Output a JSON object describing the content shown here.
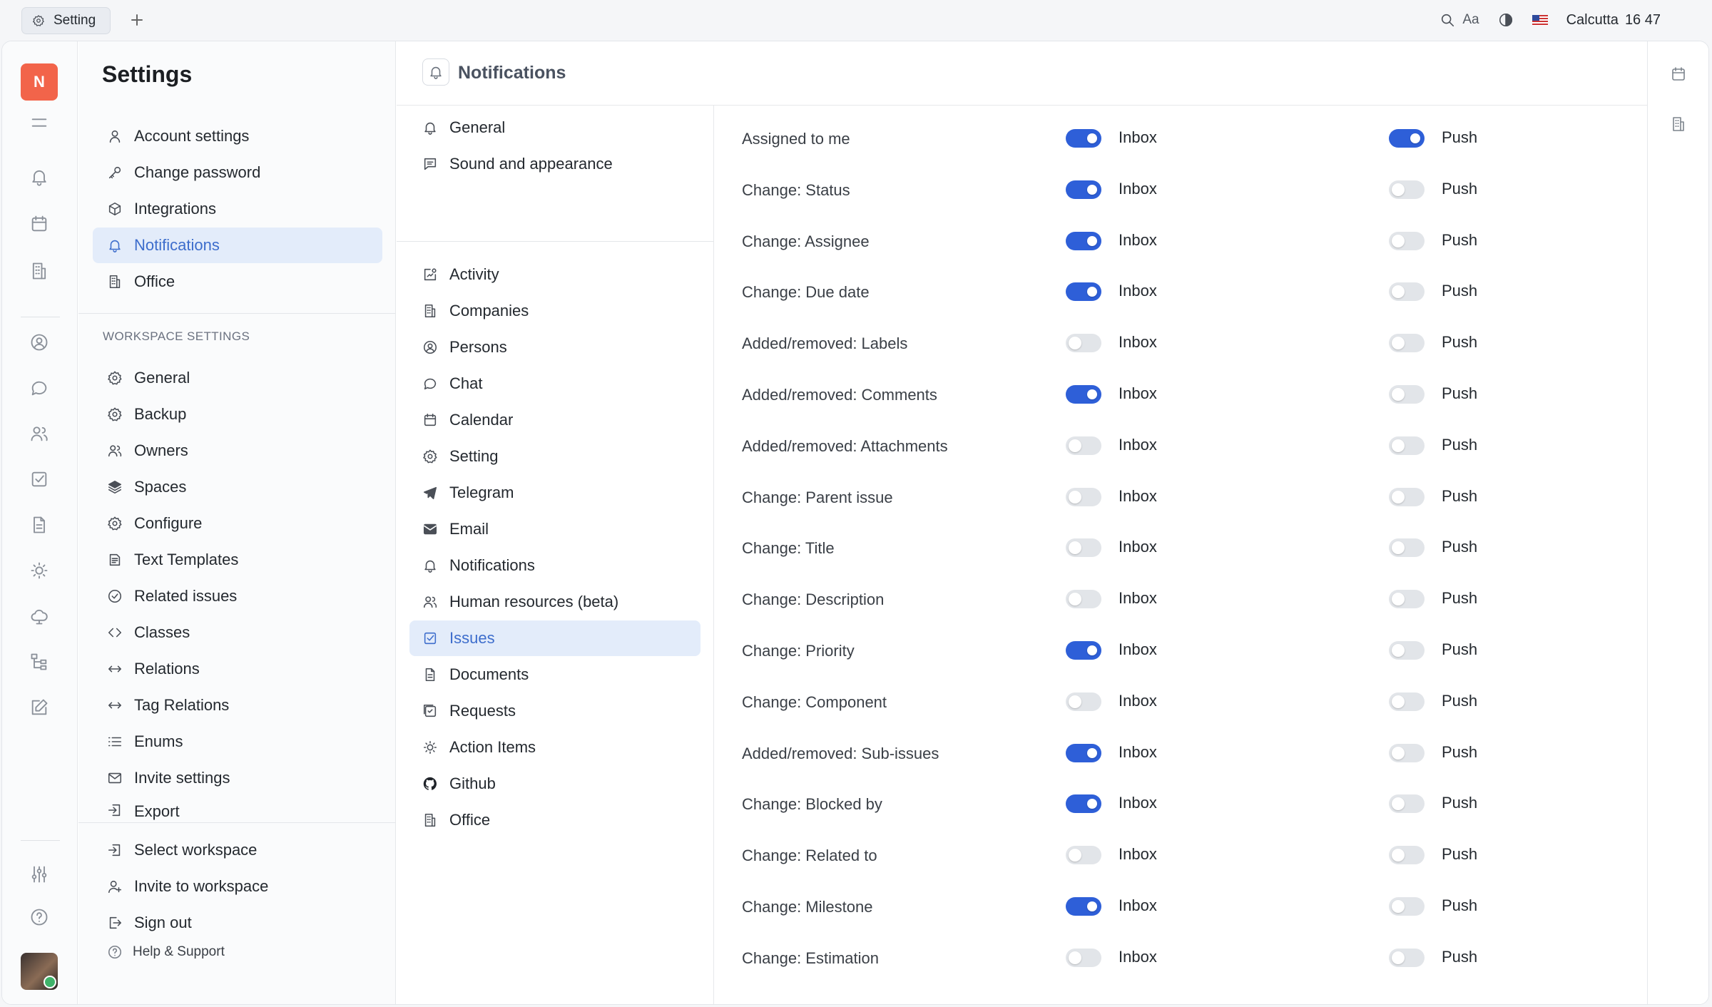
{
  "topbar": {
    "tab_label": "Setting",
    "font_label": "Aa",
    "city": "Calcutta",
    "time": "16 47"
  },
  "rail": {
    "workspace_initial": "N"
  },
  "settings": {
    "title": "Settings",
    "account_items": [
      {
        "label": "Account settings",
        "icon": "user-icon"
      },
      {
        "label": "Change password",
        "icon": "key-icon"
      },
      {
        "label": "Integrations",
        "icon": "cube-icon"
      },
      {
        "label": "Notifications",
        "icon": "bell-icon",
        "active": true
      },
      {
        "label": "Office",
        "icon": "building-icon"
      }
    ],
    "workspace_heading": "WORKSPACE SETTINGS",
    "workspace_items": [
      {
        "label": "General",
        "icon": "gear-icon"
      },
      {
        "label": "Backup",
        "icon": "gear-icon"
      },
      {
        "label": "Owners",
        "icon": "users-icon"
      },
      {
        "label": "Spaces",
        "icon": "layers-icon"
      },
      {
        "label": "Configure",
        "icon": "gear-icon"
      },
      {
        "label": "Text Templates",
        "icon": "template-icon"
      },
      {
        "label": "Related issues",
        "icon": "check-circle-icon"
      },
      {
        "label": "Classes",
        "icon": "code-icon"
      },
      {
        "label": "Relations",
        "icon": "arrows-icon"
      },
      {
        "label": "Tag Relations",
        "icon": "arrows-icon"
      },
      {
        "label": "Enums",
        "icon": "list-icon"
      },
      {
        "label": "Invite settings",
        "icon": "mail-icon"
      },
      {
        "label": "Export",
        "icon": "export-icon"
      }
    ],
    "bottom_items": [
      {
        "label": "Select workspace",
        "icon": "enter-icon"
      },
      {
        "label": "Invite to workspace",
        "icon": "user-plus-icon"
      },
      {
        "label": "Sign out",
        "icon": "signout-icon"
      }
    ],
    "help_label": "Help & Support"
  },
  "content": {
    "title": "Notifications",
    "top_categories": [
      {
        "label": "General",
        "icon": "bell-icon"
      },
      {
        "label": "Sound and appearance",
        "icon": "message-icon"
      }
    ],
    "categories": [
      {
        "label": "Activity",
        "icon": "activity-icon"
      },
      {
        "label": "Companies",
        "icon": "building-icon"
      },
      {
        "label": "Persons",
        "icon": "person-circle-icon"
      },
      {
        "label": "Chat",
        "icon": "chat-icon"
      },
      {
        "label": "Calendar",
        "icon": "calendar-icon"
      },
      {
        "label": "Setting",
        "icon": "gear-icon"
      },
      {
        "label": "Telegram",
        "icon": "telegram-icon"
      },
      {
        "label": "Email",
        "icon": "mail-filled-icon"
      },
      {
        "label": "Notifications",
        "icon": "bell-icon"
      },
      {
        "label": "Human resources (beta)",
        "icon": "users-icon"
      },
      {
        "label": "Issues",
        "icon": "checkbox-icon",
        "active": true
      },
      {
        "label": "Documents",
        "icon": "document-icon"
      },
      {
        "label": "Requests",
        "icon": "request-icon"
      },
      {
        "label": "Action Items",
        "icon": "sun-icon"
      },
      {
        "label": "Github",
        "icon": "github-icon"
      },
      {
        "label": "Office",
        "icon": "building-icon"
      }
    ],
    "inbox_label": "Inbox",
    "push_label": "Push",
    "rows": [
      {
        "label": "Assigned to me",
        "inbox": true,
        "push": true
      },
      {
        "label": "Change: Status",
        "inbox": true,
        "push": false
      },
      {
        "label": "Change: Assignee",
        "inbox": true,
        "push": false
      },
      {
        "label": "Change: Due date",
        "inbox": true,
        "push": false
      },
      {
        "label": "Added/removed: Labels",
        "inbox": false,
        "push": false
      },
      {
        "label": "Added/removed: Comments",
        "inbox": true,
        "push": false
      },
      {
        "label": "Added/removed: Attachments",
        "inbox": false,
        "push": false
      },
      {
        "label": "Change: Parent issue",
        "inbox": false,
        "push": false
      },
      {
        "label": "Change: Title",
        "inbox": false,
        "push": false
      },
      {
        "label": "Change: Description",
        "inbox": false,
        "push": false
      },
      {
        "label": "Change: Priority",
        "inbox": true,
        "push": false
      },
      {
        "label": "Change: Component",
        "inbox": false,
        "push": false
      },
      {
        "label": "Added/removed: Sub-issues",
        "inbox": true,
        "push": false
      },
      {
        "label": "Change: Blocked by",
        "inbox": true,
        "push": false
      },
      {
        "label": "Change: Related to",
        "inbox": false,
        "push": false
      },
      {
        "label": "Change: Milestone",
        "inbox": true,
        "push": false
      },
      {
        "label": "Change: Estimation",
        "inbox": false,
        "push": false
      }
    ]
  }
}
